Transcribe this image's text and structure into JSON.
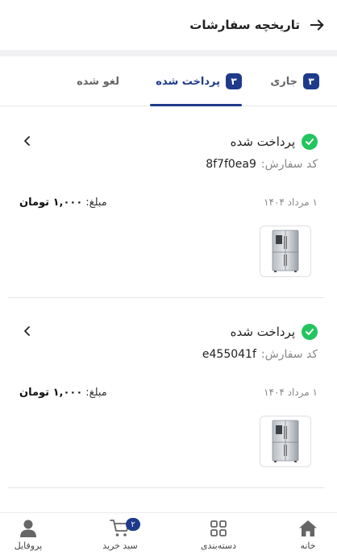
{
  "header": {
    "title": "تاریخچه سفارشات",
    "back_icon": "arrow-right-icon"
  },
  "tabs": [
    {
      "label": "جاری",
      "badge": "۳"
    },
    {
      "label": "پرداخت شده",
      "badge": "۳"
    },
    {
      "label": "لغو شده"
    }
  ],
  "orders": [
    {
      "status": "پرداخت شده",
      "code_label": "کد سفارش:",
      "code": "8f7f0ea9",
      "date": "۱ مرداد ۱۴۰۴",
      "amount_label": "مبلغ:",
      "amount": "۱,۰۰۰ تومان"
    },
    {
      "status": "پرداخت شده",
      "code_label": "کد سفارش:",
      "code": "e455041f",
      "date": "۱ مرداد ۱۴۰۴",
      "amount_label": "مبلغ:",
      "amount": "۱,۰۰۰ تومان"
    }
  ],
  "bottom_nav": {
    "home": "خانه",
    "categories": "دسته‌بندی",
    "cart": "سبد خرید",
    "cart_badge": "۲",
    "profile": "پروفایل"
  },
  "colors": {
    "accent": "#1e3a8a",
    "success": "#22c55e"
  }
}
